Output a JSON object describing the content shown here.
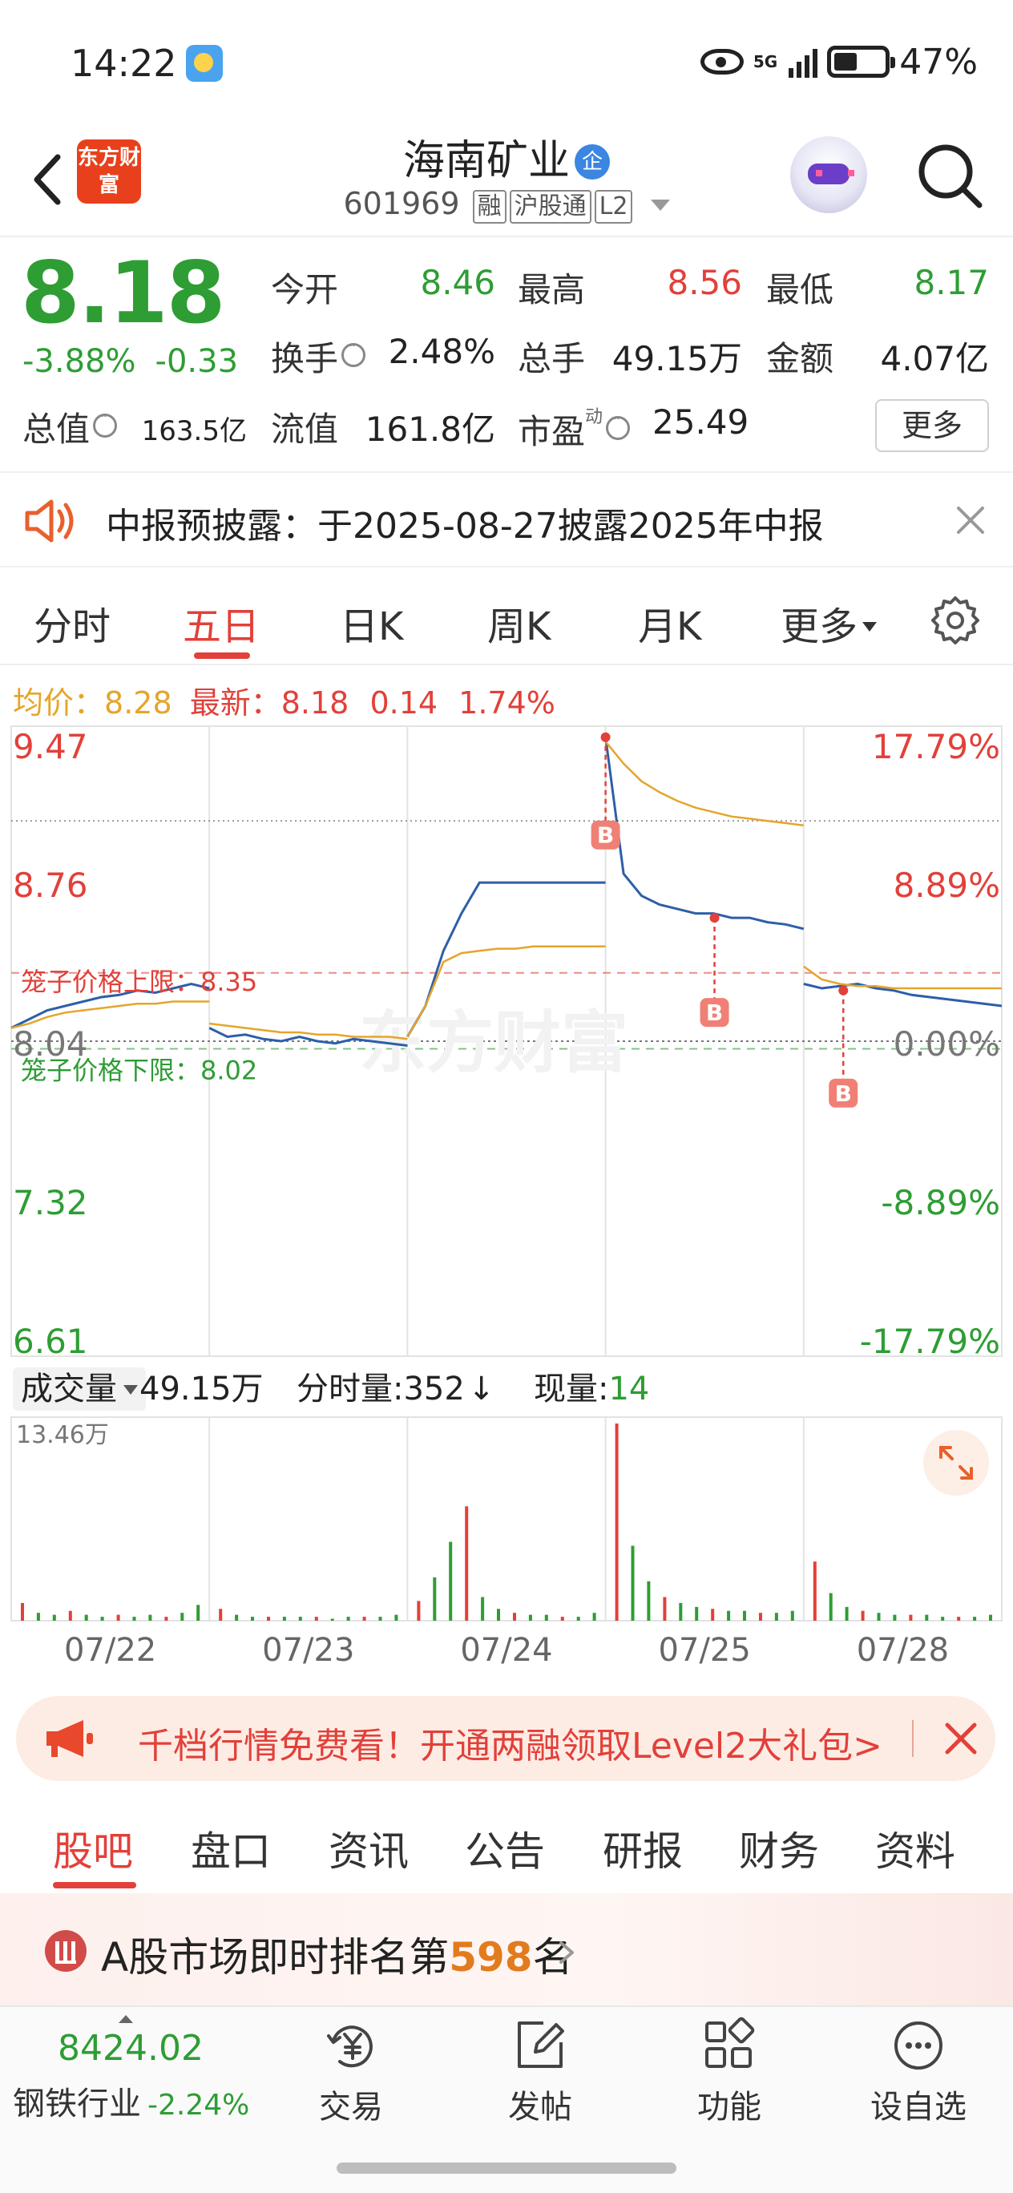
{
  "status_bar": {
    "time": "14:22",
    "network": "5G",
    "battery": "47%"
  },
  "header": {
    "logo_text": "东方财富",
    "stock_name": "海南矿业",
    "badge": "企",
    "stock_code": "601969",
    "tags": [
      "融",
      "沪股通",
      "L2"
    ]
  },
  "quote": {
    "price": "8.18",
    "change_pct": "-3.88%",
    "change_amt": "-0.33",
    "open_label": "今开",
    "open": "8.46",
    "high_label": "最高",
    "high": "8.56",
    "low_label": "最低",
    "low": "8.17",
    "turnover_label": "换手",
    "turnover": "2.48%",
    "volume_label": "总手",
    "volume": "49.15万",
    "amount_label": "金额",
    "amount": "4.07亿",
    "mktcap_label": "总值",
    "mktcap": "163.5亿",
    "float_label": "流值",
    "float_cap": "161.8亿",
    "pe_label": "市盈",
    "pe_sup": "动",
    "pe": "25.49",
    "more_label": "更多"
  },
  "notice": {
    "text": "中报预披露：于2025-08-27披露2025年中报"
  },
  "chart_tabs": [
    {
      "label": "分时"
    },
    {
      "label": "五日"
    },
    {
      "label": "日K"
    },
    {
      "label": "周K"
    },
    {
      "label": "月K"
    },
    {
      "label": "更多"
    }
  ],
  "chart_info": {
    "avg_label": "均价：",
    "avg_value": "8.28",
    "latest_label": "最新：",
    "latest_value": "8.18",
    "chg_value": "0.14",
    "chg_pct": "1.74%"
  },
  "chart_data": {
    "type": "line",
    "y_ticks": [
      "9.47",
      "8.76",
      "8.04",
      "7.32",
      "6.61"
    ],
    "pct_ticks": [
      "17.79%",
      "8.89%",
      "0.00%",
      "-8.89%",
      "-17.79%"
    ],
    "ylim": [
      6.61,
      9.47
    ],
    "ref_price": 8.04,
    "limit_upper_label": "笼子价格上限：8.35",
    "limit_upper": 8.35,
    "limit_lower_label": "笼子价格下限：8.02",
    "limit_lower": 8.02,
    "watermark": "东方财富",
    "days": [
      "07/22",
      "07/23",
      "07/24",
      "07/25",
      "07/28"
    ],
    "price_series": [
      [
        8.1,
        8.14,
        8.18,
        8.2,
        8.22,
        8.24,
        8.25,
        8.27,
        8.26,
        8.28,
        8.3,
        8.28
      ],
      [
        8.1,
        8.06,
        8.07,
        8.05,
        8.04,
        8.06,
        8.04,
        8.03,
        8.05,
        8.04,
        8.03,
        8.02
      ],
      [
        8.06,
        8.2,
        8.45,
        8.62,
        8.76,
        8.76,
        8.76,
        8.76,
        8.76,
        8.76,
        8.76,
        8.76
      ],
      [
        9.42,
        8.8,
        8.7,
        8.66,
        8.64,
        8.62,
        8.62,
        8.6,
        8.6,
        8.58,
        8.57,
        8.55
      ],
      [
        8.3,
        8.28,
        8.29,
        8.3,
        8.28,
        8.27,
        8.25,
        8.24,
        8.23,
        8.22,
        8.21,
        8.2
      ]
    ],
    "avg_series": [
      [
        8.1,
        8.12,
        8.15,
        8.17,
        8.18,
        8.19,
        8.2,
        8.21,
        8.21,
        8.22,
        8.22,
        8.22
      ],
      [
        8.12,
        8.11,
        8.1,
        8.09,
        8.08,
        8.08,
        8.07,
        8.07,
        8.06,
        8.06,
        8.06,
        8.05
      ],
      [
        8.06,
        8.2,
        8.4,
        8.44,
        8.45,
        8.46,
        8.46,
        8.47,
        8.47,
        8.47,
        8.47,
        8.47
      ],
      [
        9.4,
        9.3,
        9.22,
        9.17,
        9.13,
        9.1,
        9.08,
        9.06,
        9.05,
        9.04,
        9.03,
        9.02
      ],
      [
        8.38,
        8.32,
        8.3,
        8.29,
        8.29,
        8.28,
        8.28,
        8.28,
        8.28,
        8.28,
        8.28,
        8.28
      ]
    ],
    "buy_marks": [
      {
        "day": 3,
        "pos": 0.0,
        "price": 9.42
      },
      {
        "day": 3,
        "pos": 0.55,
        "price": 8.6
      },
      {
        "day": 4,
        "pos": 0.2,
        "price": 8.27
      }
    ],
    "buy_mark_label": "B",
    "volume_max_label": "13.46万",
    "volume_bars": [
      [
        9,
        4,
        3,
        5,
        3,
        2,
        3,
        2,
        3,
        2,
        4,
        8
      ],
      [
        6,
        3,
        2,
        2,
        2,
        2,
        2,
        1,
        2,
        2,
        2,
        3
      ],
      [
        10,
        22,
        40,
        58,
        12,
        6,
        4,
        3,
        3,
        2,
        2,
        4
      ],
      [
        100,
        38,
        20,
        12,
        9,
        7,
        6,
        5,
        5,
        4,
        4,
        5
      ],
      [
        30,
        14,
        7,
        5,
        4,
        3,
        3,
        3,
        2,
        2,
        2,
        3
      ]
    ]
  },
  "volume_info": {
    "selector_label": "成交量",
    "total": "49.15万",
    "tick_label": "分时量:352",
    "now_label": "现量:",
    "now_value": "14"
  },
  "promo": {
    "text": "千档行情免费看！开通两融领取Level2大礼包>"
  },
  "content_tabs": [
    {
      "label": "股吧"
    },
    {
      "label": "盘口"
    },
    {
      "label": "资讯"
    },
    {
      "label": "公告"
    },
    {
      "label": "研报"
    },
    {
      "label": "财务"
    },
    {
      "label": "资料"
    }
  ],
  "rank": {
    "prefix": "A股市场即时排名第",
    "number": "598",
    "suffix": "名"
  },
  "bottom_nav": {
    "index_value": "8424.02",
    "index_name": "钢铁行业",
    "index_change": "-2.24%",
    "items": [
      {
        "label": "交易",
        "icon": "trade-yen-icon"
      },
      {
        "label": "发帖",
        "icon": "compose-icon"
      },
      {
        "label": "功能",
        "icon": "grid-icon"
      },
      {
        "label": "设自选",
        "icon": "more-dots-icon"
      }
    ]
  },
  "colors": {
    "up": "#e2403a",
    "down": "#2e9d34",
    "price_line": "#2d5fa8",
    "avg_line": "#e5a52b",
    "accent": "#e2403a"
  }
}
